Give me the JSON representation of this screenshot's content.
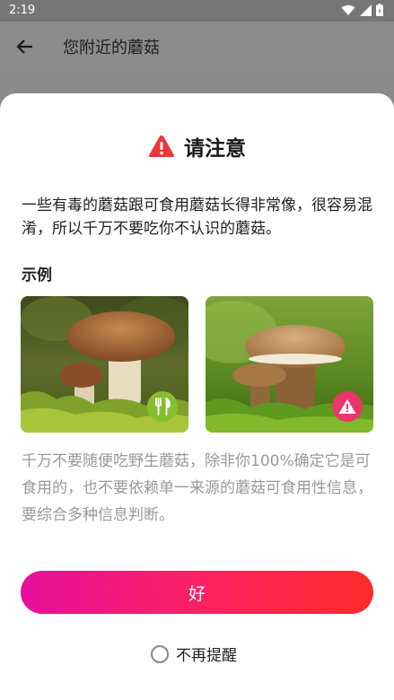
{
  "status_bar": {
    "time": "2:19"
  },
  "app_bar": {
    "title": "您附近的蘑菇"
  },
  "dialog": {
    "title": "请注意",
    "intro": "一些有毒的蘑菇跟可食用蘑菇长得非常像，很容易混淆，所以千万不要吃你不认识的蘑菇。",
    "example_heading": "示例",
    "examples": [
      {
        "badge_icon": "fork-knife-icon",
        "badge_color": "#86bf2e"
      },
      {
        "badge_icon": "warning-icon",
        "badge_color": "#e8386a"
      }
    ],
    "caution": "千万不要随便吃野生蘑菇，除非你100%确定它是可食用的，也不要依赖单一来源的蘑菇可食用性信息，要综合多种信息判断。",
    "ok_label": "好",
    "dont_remind_label": "不再提醒"
  },
  "colors": {
    "accent_start": "#e80f9c",
    "accent_end": "#ff2a2a",
    "warning": "#e8383d"
  }
}
